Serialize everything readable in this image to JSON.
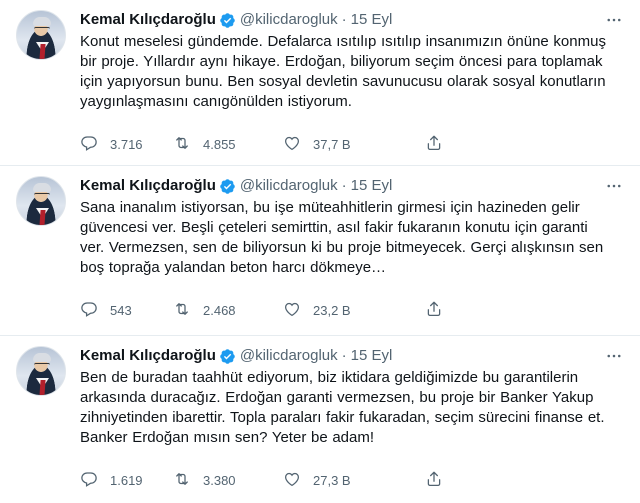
{
  "colors": {
    "text": "#0f1419",
    "muted": "#536471",
    "verified": "#1d9bf0",
    "divider": "#e6ecf0"
  },
  "tweets": [
    {
      "name": "Kemal Kılıçdaroğlu",
      "handle": "@kilicdarogluk",
      "dot": "·",
      "date": "15 Eyl",
      "text": "Konut meselesi gündemde. Defalarca ısıtılıp ısıtılıp insanımızın önüne konmuş bir proje. Yıllardır aynı hikaye. Erdoğan, biliyorum seçim öncesi para toplamak için yapıyorsun bunu. Ben sosyal devletin savunucusu olarak sosyal konutların yaygınlaşmasını canıgönülden istiyorum.",
      "replies": "3.716",
      "retweets": "4.855",
      "likes": "37,7 B"
    },
    {
      "name": "Kemal Kılıçdaroğlu",
      "handle": "@kilicdarogluk",
      "dot": "·",
      "date": "15 Eyl",
      "text": "Sana inanalım istiyorsan, bu işe müteahhitlerin girmesi için hazineden gelir güvencesi ver. Beşli çeteleri semirttin, asıl fakir fukaranın konutu için garanti ver. Vermezsen, sen de biliyorsun ki bu proje bitmeyecek. Gerçi alışkınsın sen boş toprağa yalandan beton harcı dökmeye…",
      "replies": "543",
      "retweets": "2.468",
      "likes": "23,2 B"
    },
    {
      "name": "Kemal Kılıçdaroğlu",
      "handle": "@kilicdarogluk",
      "dot": "·",
      "date": "15 Eyl",
      "text": "Ben de buradan taahhüt ediyorum, biz iktidara geldiğimizde bu garantilerin arkasında duracağız. Erdoğan garanti vermezsen, bu proje bir Banker Yakup zihniyetinden ibarettir. Topla paraları fakir fukaradan, seçim sürecini finanse et. Banker Erdoğan mısın sen? Yeter be adam!",
      "replies": "1.619",
      "retweets": "3.380",
      "likes": "27,3 B"
    }
  ]
}
